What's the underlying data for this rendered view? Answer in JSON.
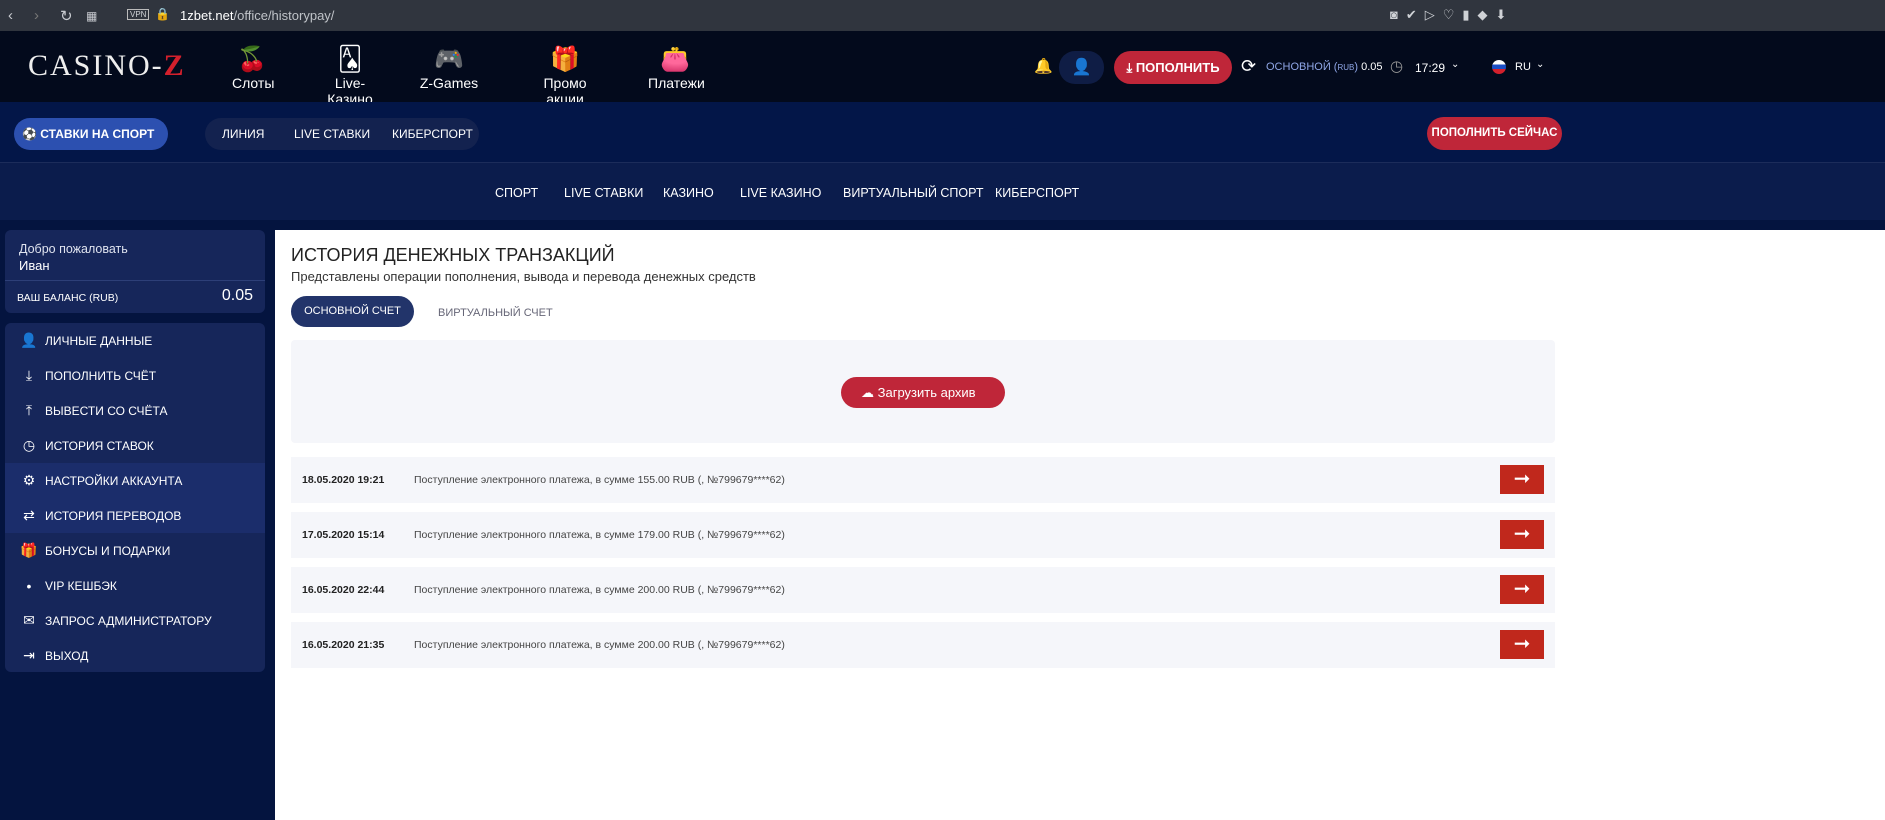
{
  "browser": {
    "url_domain": "1zbet.net",
    "url_path": "/office/historypay/",
    "vpn": "VPN"
  },
  "header": {
    "logo": "CASINO-Z",
    "nav": [
      {
        "label": "Слоты",
        "icon": "cherry-icon"
      },
      {
        "label": "Live-Казино",
        "icon": "cards-icon"
      },
      {
        "label": "Z-Games",
        "icon": "gamepad-icon"
      },
      {
        "label": "Промо акции",
        "icon": "gift-icon"
      },
      {
        "label": "Платежи",
        "icon": "wallet-icon"
      }
    ],
    "deposit": "ПОПОЛНИТЬ",
    "account_label": "ОСНОВНОЙ (",
    "currency": "RUB",
    "account_close": ")",
    "balance": "0.05",
    "time": "17:29",
    "lang": "RU"
  },
  "sportbar": {
    "sport_bets": "СТАВКИ НА СПОРТ",
    "tabs": [
      "ЛИНИЯ",
      "LIVE СТАВКИ",
      "КИБЕРСПОРТ"
    ],
    "deposit_now": "ПОПОЛНИТЬ СЕЙЧАС"
  },
  "thirdnav": [
    "СПОРТ",
    "LIVE СТАВКИ",
    "КАЗИНО",
    "LIVE КАЗИНО",
    "ВИРТУАЛЬНЫЙ СПОРТ",
    "КИБЕРСПОРТ"
  ],
  "sidebar": {
    "welcome": "Добро пожаловать",
    "name": "Иван",
    "balance_label": "ВАШ БАЛАНС (RUB)",
    "balance": "0.05",
    "items": [
      {
        "label": "ЛИЧНЫЕ ДАННЫЕ",
        "icon": "👤"
      },
      {
        "label": "ПОПОЛНИТЬ СЧЁТ",
        "icon": "⤓"
      },
      {
        "label": "ВЫВЕСТИ СО СЧЁТА",
        "icon": "⤒"
      },
      {
        "label": "ИСТОРИЯ СТАВОК",
        "icon": "◷"
      },
      {
        "label": "НАСТРОЙКИ АККАУНТА",
        "icon": "⚙"
      },
      {
        "label": "ИСТОРИЯ ПЕРЕВОДОВ",
        "icon": "⇄"
      },
      {
        "label": "БОНУСЫ И ПОДАРКИ",
        "icon": "🎁"
      },
      {
        "label": "VIP КЕШБЭК",
        "icon": "•"
      },
      {
        "label": "ЗАПРОС АДМИНИСТРАТОРУ",
        "icon": "✉"
      },
      {
        "label": "ВЫХОД",
        "icon": "⇥"
      }
    ]
  },
  "main": {
    "title": "ИСТОРИЯ ДЕНЕЖНЫХ ТРАНЗАКЦИЙ",
    "subtitle": "Представлены операции пополнения, вывода и перевода денежных средств",
    "tabs": [
      "ОСНОВНОЙ СЧЕТ",
      "ВИРТУАЛЬНЫЙ СЧЕТ"
    ],
    "download": "Загрузить архив",
    "rows": [
      {
        "date": "18.05.2020 19:21",
        "desc": "Поступление электронного платежа, в сумме 155.00 RUB (, №799679****62)"
      },
      {
        "date": "17.05.2020 15:14",
        "desc": "Поступление электронного платежа, в сумме 179.00 RUB (, №799679****62)"
      },
      {
        "date": "16.05.2020 22:44",
        "desc": "Поступление электронного платежа, в сумме 200.00 RUB (, №799679****62)"
      },
      {
        "date": "16.05.2020 21:35",
        "desc": "Поступление электронного платежа, в сумме 200.00 RUB (, №799679****62)"
      }
    ]
  }
}
